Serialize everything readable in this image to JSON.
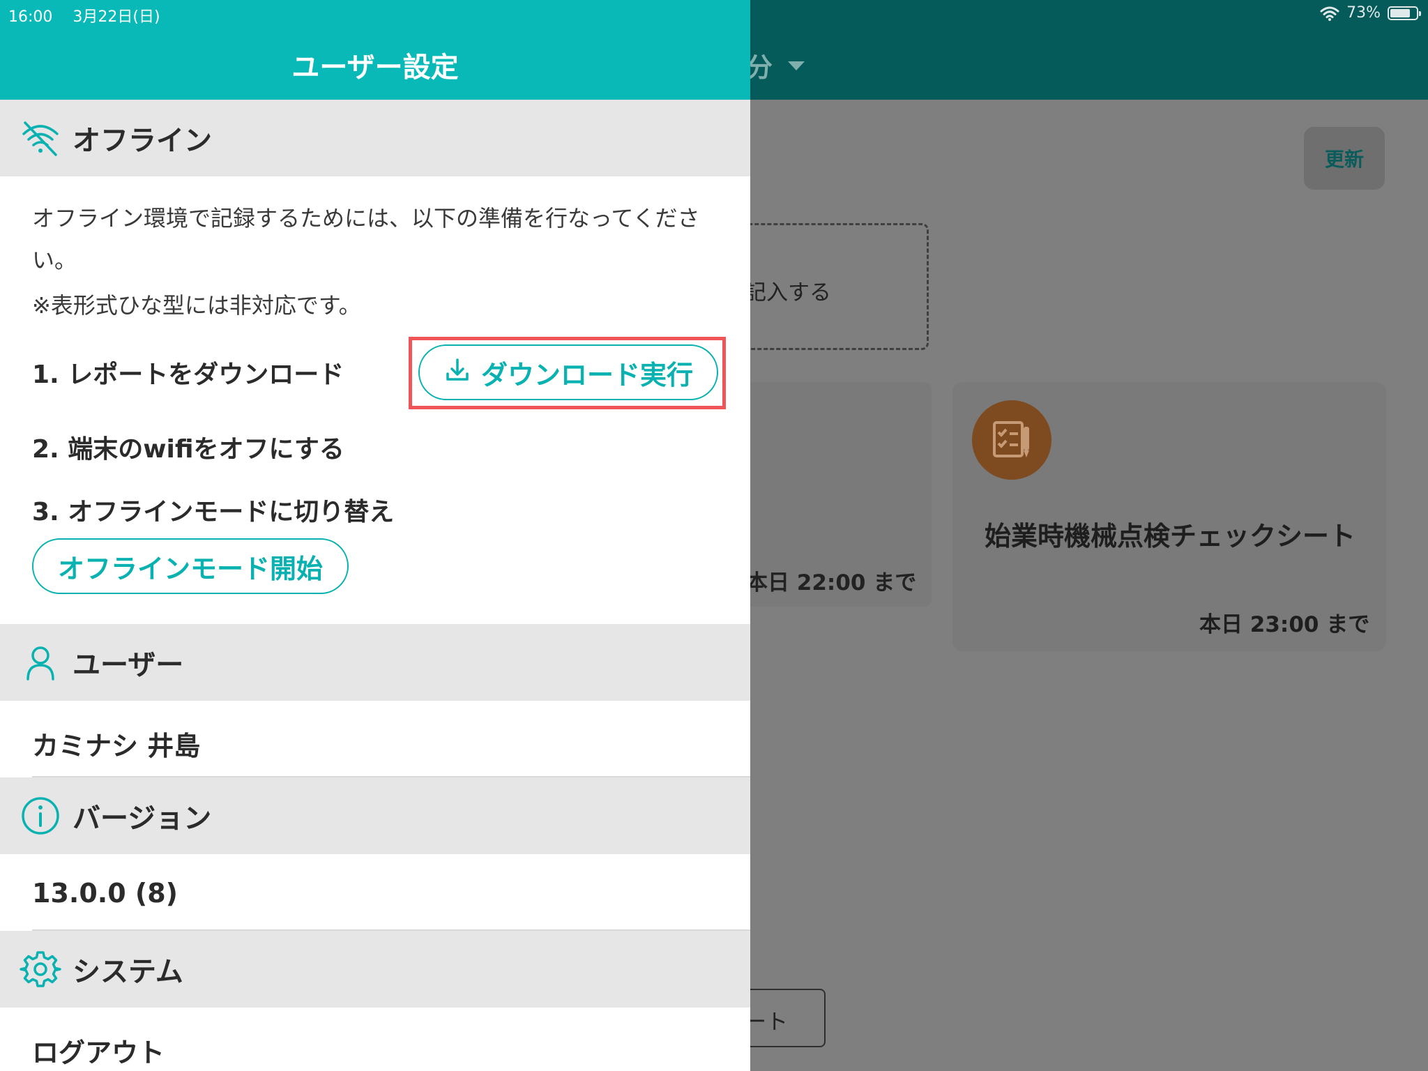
{
  "status_bar": {
    "time": "16:00",
    "date": "3月22日(日)",
    "battery": "73%"
  },
  "background": {
    "header_title_fragment": "分",
    "update_button": "更新",
    "dashed_card_text": "記入する",
    "card_left_deadline": "本日 22:00 まで",
    "card_right_title": "始業時機械点検チェックシート",
    "card_right_deadline": "本日 23:00 まで",
    "bottom_button_text": "ート"
  },
  "drawer": {
    "title": "ユーザー設定",
    "offline": {
      "title": "オフライン",
      "description": "オフライン環境で記録するためには、以下の準備を行なってください。",
      "note": "※表形式ひな型には非対応です。",
      "step1": "1. レポートをダウンロード",
      "download_button": "ダウンロード実行",
      "step2": "2. 端末のwifiをオフにする",
      "step3": "3. オフラインモードに切り替え",
      "offline_start_button": "オフラインモード開始"
    },
    "user": {
      "title": "ユーザー",
      "name": "カミナシ 井島"
    },
    "version": {
      "title": "バージョン",
      "value": "13.0.0 (8)"
    },
    "system": {
      "title": "システム",
      "logout": "ログアウト"
    }
  },
  "colors": {
    "teal": "#09b9b8",
    "highlight": "#ef5456",
    "section_bg": "#e6e6e6"
  }
}
